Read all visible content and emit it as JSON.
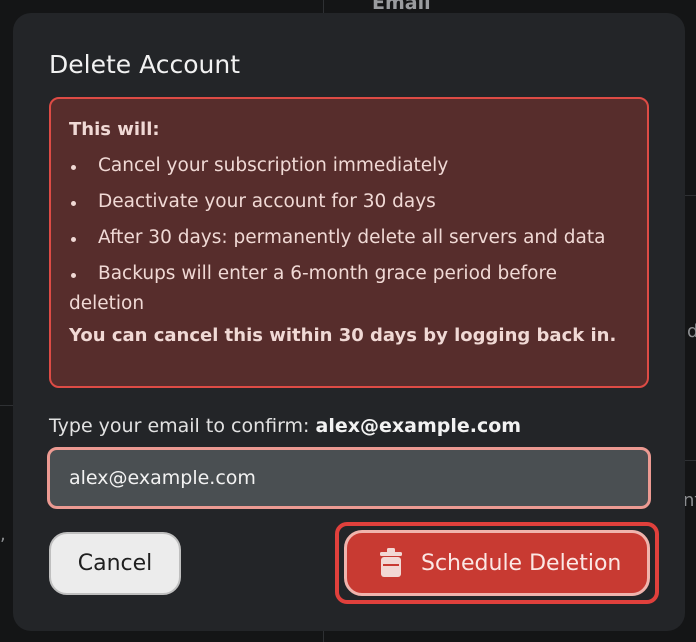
{
  "background": {
    "email_label": "Email",
    "fragment_d": "d",
    "fragment_nt": "nt",
    "fragment_comma": ","
  },
  "modal": {
    "title": "Delete Account",
    "warning": {
      "heading": "This will:",
      "items": [
        "Cancel your subscription immediately",
        "Deactivate your account for 30 days",
        "After 30 days: permanently delete all servers and data",
        "Backups will enter a 6-month grace period before deletion"
      ],
      "footer": "You can cancel this within 30 days by logging back in."
    },
    "confirm": {
      "label": "Type your email to confirm:",
      "email": "alex@example.com",
      "input_value": "alex@example.com"
    },
    "buttons": {
      "cancel_label": "Cancel",
      "delete_label": "Schedule Deletion"
    }
  },
  "colors": {
    "danger": "#c83a32",
    "danger_border": "#dd4b45",
    "warning_bg": "#572d2c",
    "modal_bg": "#232528"
  },
  "icons": {
    "delete_button_icon": "trash-icon"
  }
}
